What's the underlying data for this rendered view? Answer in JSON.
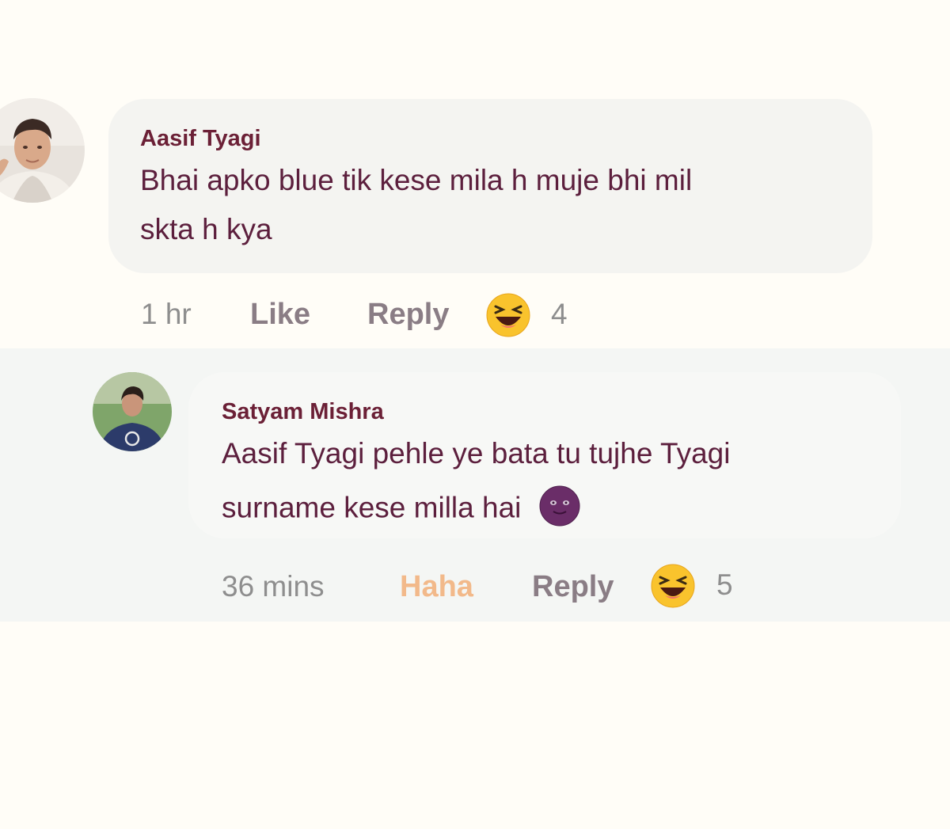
{
  "comment": {
    "author": "Aasif Tyagi",
    "text_line1": "Bhai apko blue tik kese mila h muje bhi mil",
    "text_line2": "skta h kya",
    "time": "1 hr",
    "like_label": "Like",
    "reply_label": "Reply",
    "reaction_icon": "haha-emoji-icon",
    "reaction_count": "4"
  },
  "reply": {
    "author": "Satyam Mishra",
    "text_line1": "Aasif Tyagi pehle ye bata tu tujhe Tyagi",
    "text_line2": "surname kese milla hai",
    "inline_emoji": "smiling-face-emoji-icon",
    "time": "36 mins",
    "reaction_label": "Haha",
    "reply_label": "Reply",
    "reaction_icon": "haha-emoji-icon",
    "reaction_count": "5"
  },
  "colors": {
    "author": "#6b2036",
    "text": "#5c1f3d",
    "haha_active": "#f2b98a",
    "bubble": "#f4f4f1"
  }
}
